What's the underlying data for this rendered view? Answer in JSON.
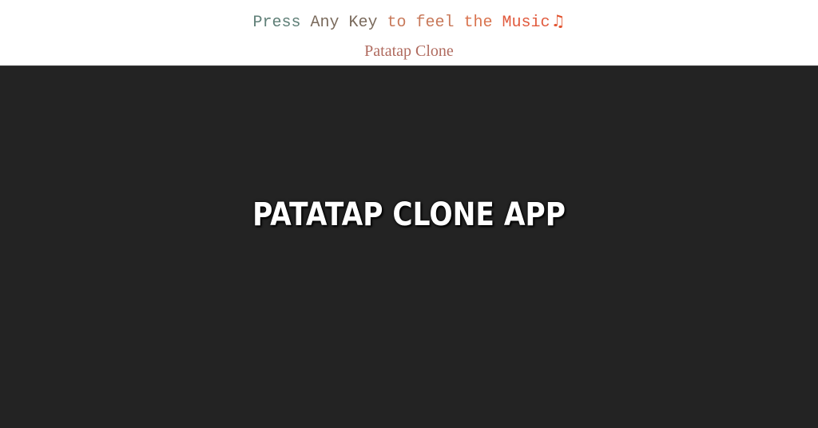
{
  "header": {
    "tagline": {
      "part1": "Press ",
      "part2": "Any Key ",
      "part3": "to feel ",
      "part4": "the ",
      "part5": "Music",
      "icon": "music-note-icon",
      "icon_glyph": "♫"
    },
    "subtitle": "Patatap Clone"
  },
  "stage": {
    "title": "PATATAP CLONE APP",
    "background": "#232323"
  },
  "colors": {
    "tagline_start": "#5f7f77",
    "tagline_end": "#e15a3d",
    "subtitle": "#b06b5f"
  }
}
